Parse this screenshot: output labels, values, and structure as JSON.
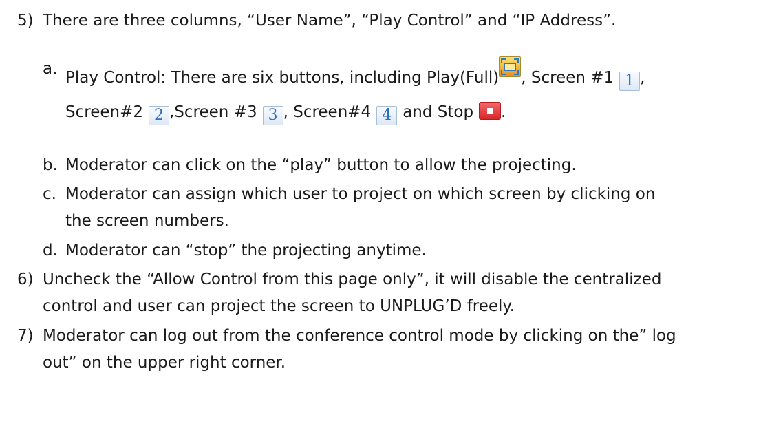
{
  "items": {
    "item5": {
      "num": "5)",
      "text": "There are three columns, “User Name”, “Play Control” and “IP Address”."
    },
    "sub_a": {
      "label": "a.",
      "line1_a": "Play Control: There are six buttons, including Play(Full)",
      "line1_b": ", Screen #1",
      "line1_c": ",",
      "line2_a": "Screen#2",
      "line2_b": ",Screen #3",
      "line2_c": ", Screen#4",
      "line2_d": "and Stop",
      "line2_e": "."
    },
    "sub_b": {
      "label": "b.",
      "text": "Moderator can click on the “play” button to allow the projecting."
    },
    "sub_c": {
      "label": "c.",
      "line1": "Moderator can assign which user to project on which screen by clicking on",
      "line2": "the screen numbers."
    },
    "sub_d": {
      "label": "d.",
      "text": "Moderator can “stop” the projecting anytime."
    },
    "item6": {
      "num": "6)",
      "line1": "Uncheck the “Allow Control from this page only”, it will disable the centralized",
      "line2": "control and user can project the screen to UNPLUG’D freely."
    },
    "item7": {
      "num": "7)",
      "line1": "Moderator can log out from the conference control mode by clicking on the” log",
      "line2": "out” on the upper right corner."
    }
  },
  "icons": {
    "screen1": "1",
    "screen2": "2",
    "screen3": "3",
    "screen4": "4",
    "full": "fullscreen-icon",
    "stop": "stop-icon"
  }
}
